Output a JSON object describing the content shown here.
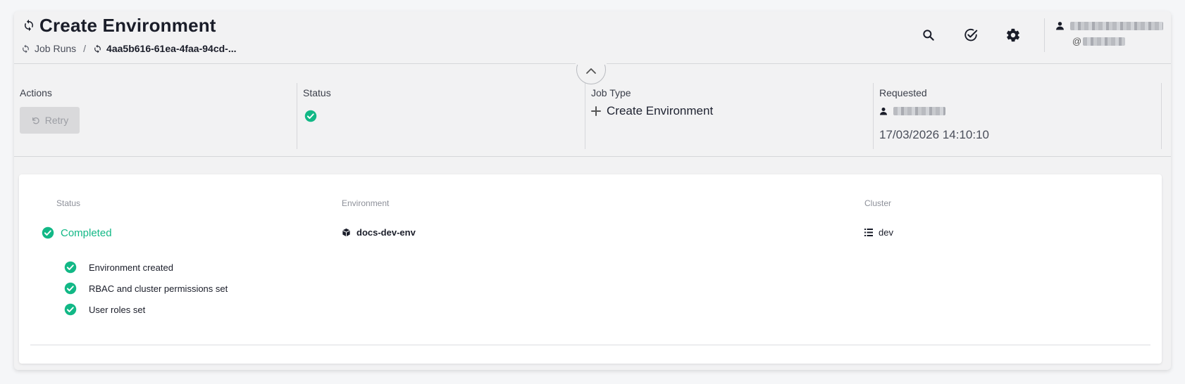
{
  "header": {
    "title": "Create Environment",
    "title_icon": "sync-icon",
    "breadcrumb": {
      "parent_label": "Job Runs",
      "separator": "/",
      "current_label": "4aa5b616-61ea-4faa-94cd-..."
    },
    "actions": [
      {
        "name": "search-button",
        "icon": "search-icon"
      },
      {
        "name": "approvals-button",
        "icon": "check-circle-icon"
      },
      {
        "name": "settings-button",
        "icon": "gear-icon"
      }
    ],
    "user": {
      "handle_prefix": "@"
    }
  },
  "info": {
    "actions_label": "Actions",
    "retry_label": "Retry",
    "status_label": "Status",
    "job_type_label": "Job Type",
    "job_type_value": "Create Environment",
    "requested_label": "Requested",
    "requested_date": "17/03/2026 14:10:10"
  },
  "details": {
    "headers": {
      "status": "Status",
      "environment": "Environment",
      "cluster": "Cluster"
    },
    "status_value": "Completed",
    "environment_value": "docs-dev-env",
    "cluster_value": "dev",
    "steps": [
      {
        "label": "Environment created"
      },
      {
        "label": "RBAC and cluster permissions set"
      },
      {
        "label": "User roles set"
      }
    ]
  },
  "colors": {
    "success": "#12b886",
    "text": "#1a1d29",
    "muted": "#8d9099",
    "card_bg": "#f2f2f3",
    "panel_bg": "#ffffff"
  }
}
